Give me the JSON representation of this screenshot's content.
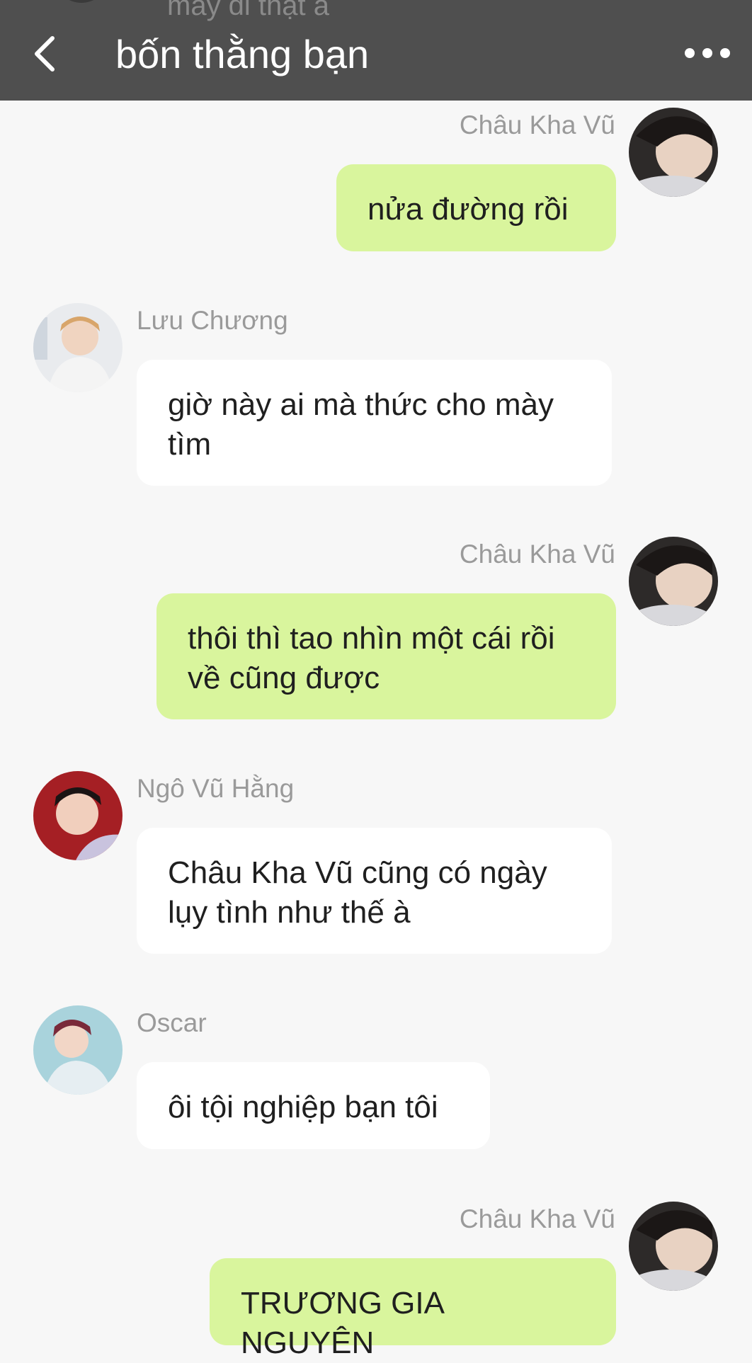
{
  "header": {
    "title": "bốn thằng bạn",
    "partial_previous_message": "mày đi thật à"
  },
  "messages": [
    {
      "sender": "Châu Kha Vũ",
      "direction": "out",
      "lines": [
        "nửa đường rồi"
      ]
    },
    {
      "sender": "Lưu Chương",
      "direction": "in",
      "lines": [
        "giờ này ai mà thức cho mày",
        "tìm"
      ]
    },
    {
      "sender": "Châu Kha Vũ",
      "direction": "out",
      "lines": [
        "thôi thì tao nhìn một cái rồi",
        "về cũng được"
      ]
    },
    {
      "sender": "Ngô Vũ Hằng",
      "direction": "in",
      "lines": [
        "Châu Kha Vũ cũng có ngày",
        "lụy tình như thế à"
      ]
    },
    {
      "sender": "Oscar",
      "direction": "in",
      "lines": [
        "ôi tội nghiệp bạn tôi"
      ]
    },
    {
      "sender": "Châu Kha Vũ",
      "direction": "out",
      "lines": [
        "TRƯƠNG GIA NGUYÊN"
      ]
    }
  ],
  "colors": {
    "header_bg": "#4f4f4f",
    "chat_bg": "#f7f7f7",
    "outgoing_bubble": "#d9f59d",
    "incoming_bubble": "#ffffff",
    "sender_name": "#9a9a9a"
  },
  "icons": [
    "back-arrow-icon",
    "more-options-icon"
  ]
}
